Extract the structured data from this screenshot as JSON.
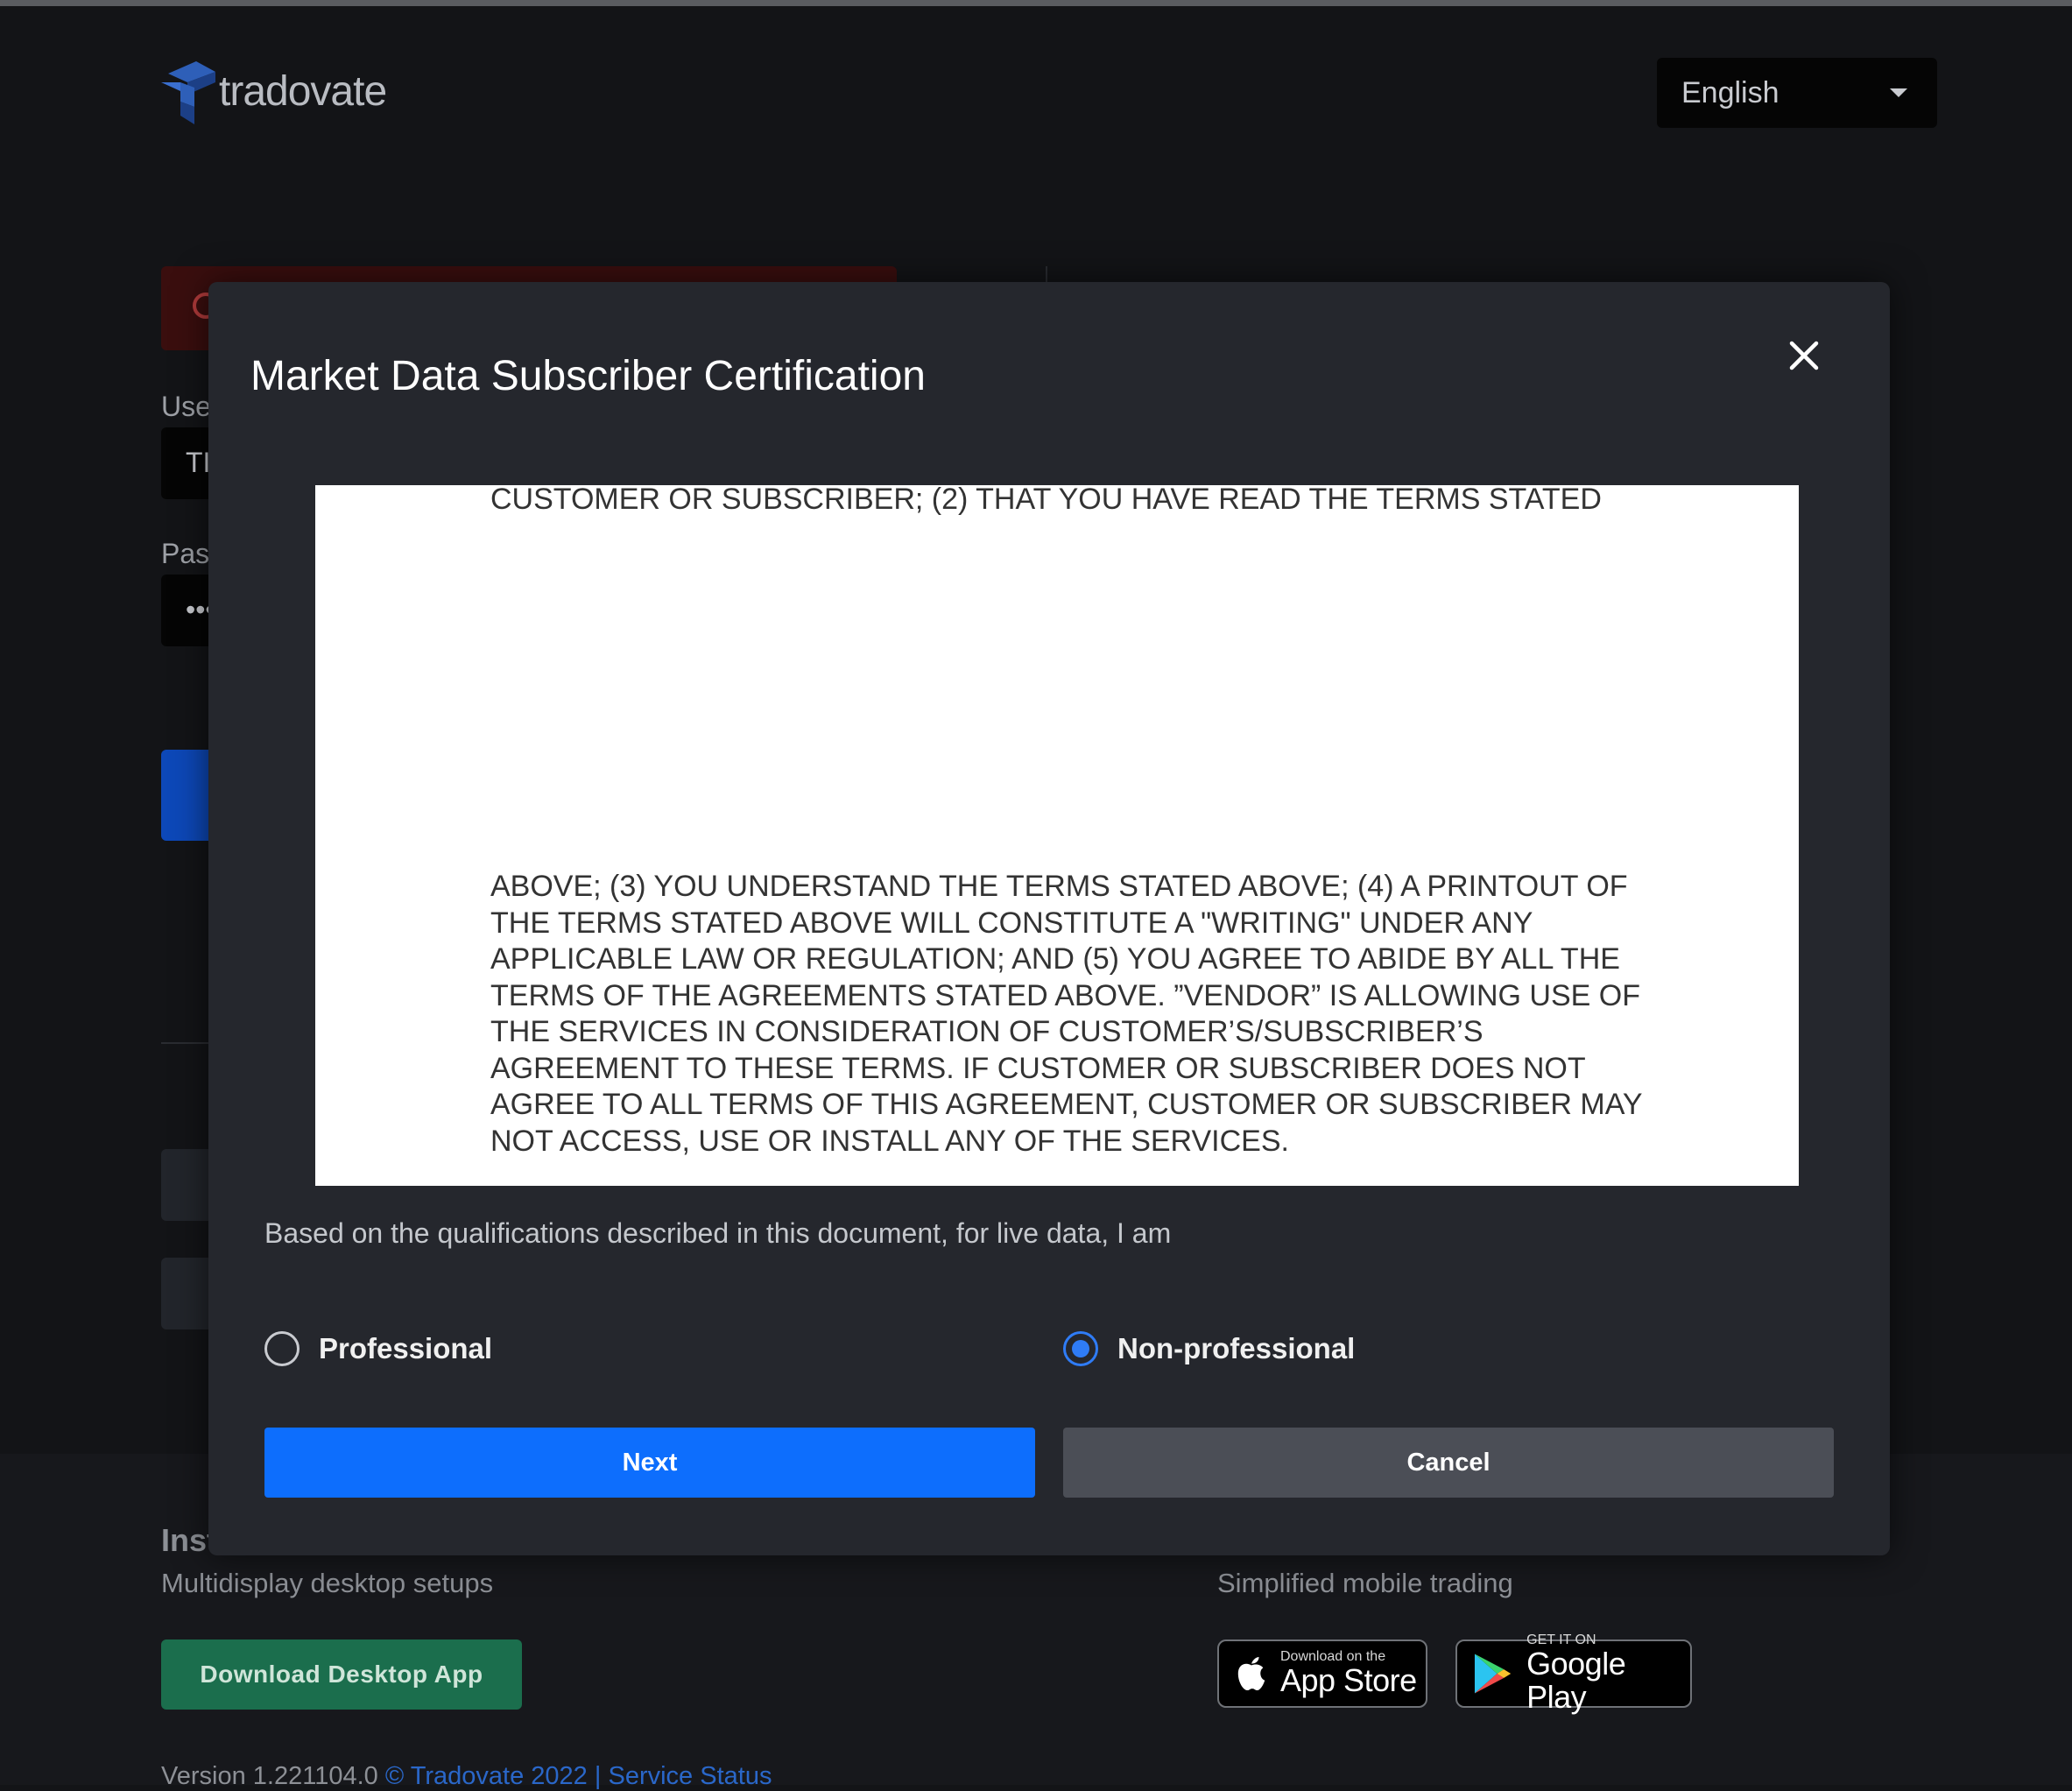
{
  "app": {
    "logo_text": "tradovate",
    "language": "English"
  },
  "login": {
    "username_label": "Use",
    "username_value": "TI",
    "password_label": "Pas",
    "password_value": "•••"
  },
  "footer": {
    "desktop_title": "Inst",
    "desktop_subtitle": "Multidisplay desktop setups",
    "download_button": "Download Desktop App",
    "mobile_subtitle": "Simplified mobile trading",
    "app_store": {
      "small": "Download on the",
      "big": "App Store"
    },
    "google_play": {
      "small": "GET IT ON",
      "big": "Google Play"
    },
    "version": "Version 1.221104.0",
    "copyright": "© Tradovate 2022",
    "separator": "|",
    "service_status": "Service Status"
  },
  "modal": {
    "title": "Market Data Subscriber Certification",
    "document": {
      "top_line": "CUSTOMER OR SUBSCRIBER; (2) THAT YOU HAVE READ THE TERMS STATED",
      "paragraph": "ABOVE; (3) YOU UNDERSTAND THE TERMS STATED ABOVE; (4) A PRINTOUT OF THE TERMS STATED ABOVE WILL CONSTITUTE A \"WRITING\" UNDER ANY APPLICABLE LAW OR REGULATION; AND (5) YOU AGREE TO ABIDE BY ALL THE TERMS OF THE AGREEMENTS STATED ABOVE. ”VENDOR” IS ALLOWING USE OF THE SERVICES IN CONSIDERATION OF CUSTOMER’S/SUBSCRIBER’S AGREEMENT TO THESE TERMS. IF CUSTOMER OR SUBSCRIBER DOES NOT AGREE TO ALL TERMS OF THIS AGREEMENT, CUSTOMER OR SUBSCRIBER MAY NOT ACCESS, USE OR INSTALL ANY OF THE SERVICES."
    },
    "prompt": "Based on the qualifications described in this document, for live data, I am",
    "options": [
      {
        "label": "Professional",
        "selected": false
      },
      {
        "label": "Non-professional",
        "selected": true
      }
    ],
    "next_label": "Next",
    "cancel_label": "Cancel"
  },
  "colors": {
    "accent": "#0d6efd",
    "radio_selected": "#2f7cf6",
    "modal_bg": "#25272d",
    "page_bg": "#131417"
  }
}
